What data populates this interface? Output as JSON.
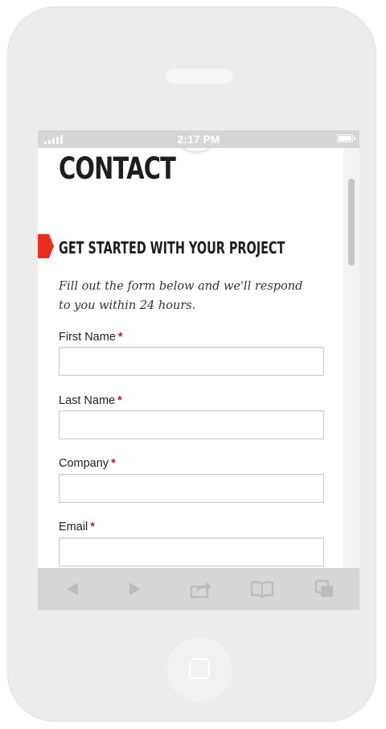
{
  "status_bar": {
    "time": "2:17 PM"
  },
  "page": {
    "title": "CONTACT",
    "section_heading": "GET STARTED WITH YOUR PROJECT",
    "intro": "Fill out the form below and we'll respond to you within 24 hours."
  },
  "form": {
    "required_marker": "*",
    "fields": [
      {
        "label": "First Name",
        "value": ""
      },
      {
        "label": "Last Name",
        "value": ""
      },
      {
        "label": "Company",
        "value": ""
      },
      {
        "label": "Email",
        "value": ""
      }
    ]
  },
  "toolbar": {
    "icons": [
      "back-icon",
      "forward-icon",
      "share-icon",
      "bookmarks-icon",
      "tabs-icon"
    ]
  },
  "colors": {
    "accent": "#e8301e",
    "required": "#c8141d",
    "chrome": "#d6d6d6",
    "phone_body": "#ececec"
  }
}
